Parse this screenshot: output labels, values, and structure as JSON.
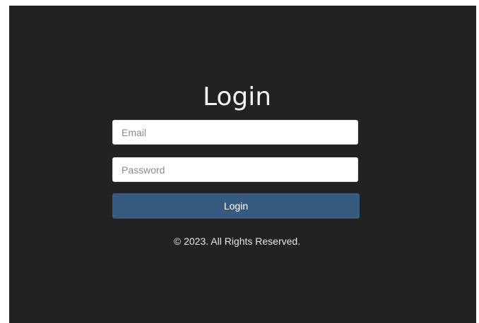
{
  "login": {
    "title": "Login",
    "email_placeholder": "Email",
    "password_placeholder": "Password",
    "button_label": "Login"
  },
  "footer": {
    "copyright": "© 2023. All Rights Reserved."
  },
  "colors": {
    "background": "#222222",
    "button": "#375a7f",
    "title_text": "#f2f2f2"
  }
}
